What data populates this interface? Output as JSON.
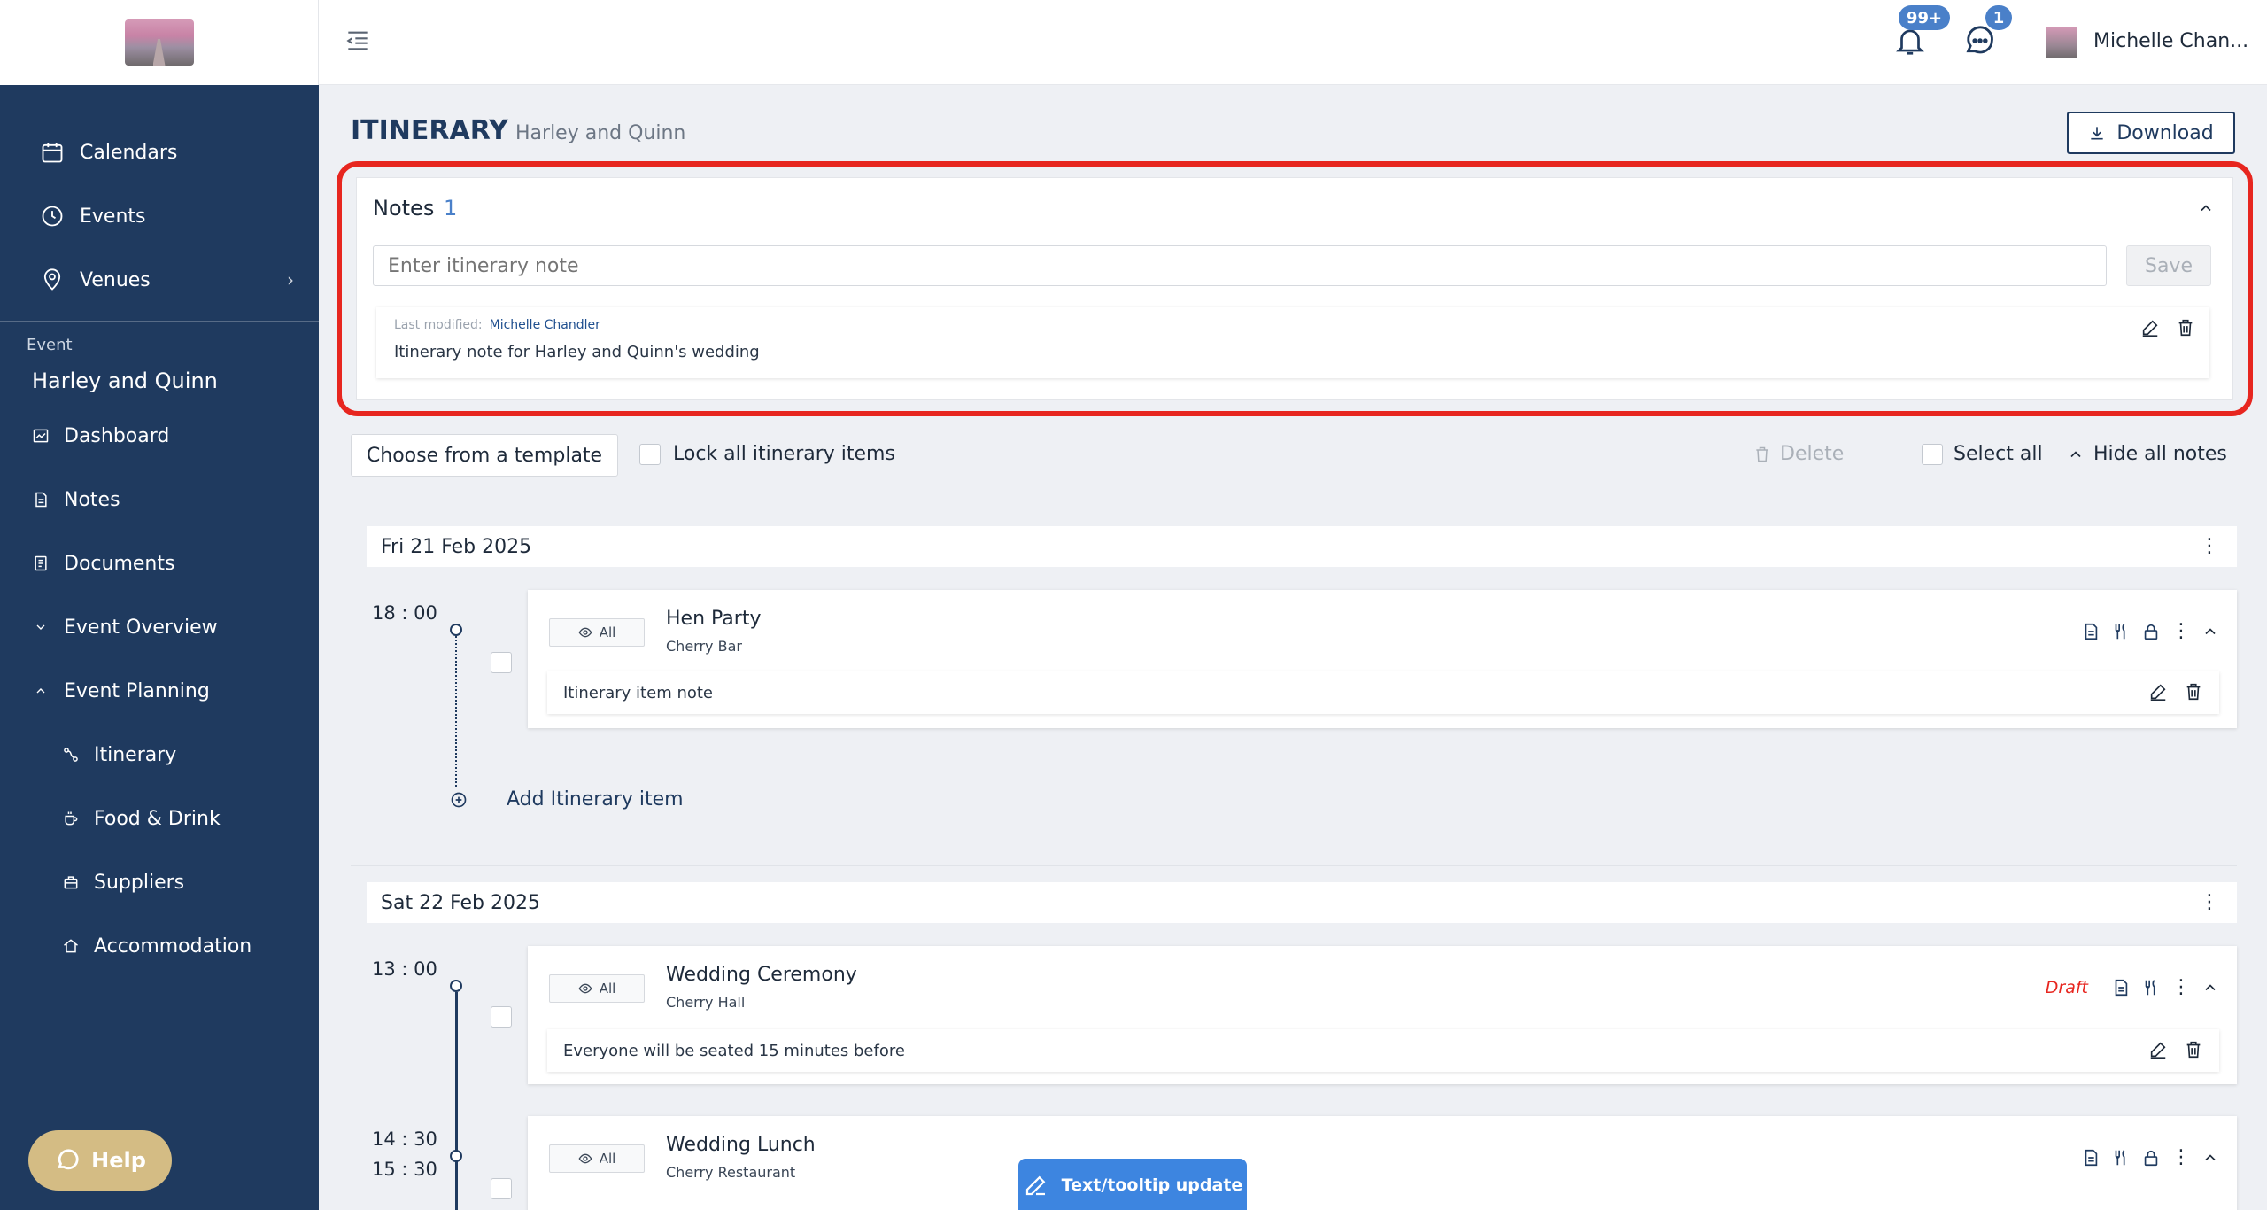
{
  "sidebar": {
    "nav": [
      {
        "label": "Calendars",
        "icon": "calendar-icon"
      },
      {
        "label": "Events",
        "icon": "clock-icon"
      },
      {
        "label": "Venues",
        "icon": "location-pin-icon"
      }
    ],
    "event_label": "Event",
    "event_name": "Harley and Quinn",
    "event_nav": [
      {
        "label": "Dashboard"
      },
      {
        "label": "Notes"
      },
      {
        "label": "Documents"
      },
      {
        "label": "Event Overview"
      },
      {
        "label": "Event Planning"
      },
      {
        "label": "Itinerary"
      },
      {
        "label": "Food & Drink"
      },
      {
        "label": "Suppliers"
      },
      {
        "label": "Accommodation"
      }
    ],
    "help_label": "Help"
  },
  "topbar": {
    "notifications_count": "99+",
    "messages_count": "1",
    "user_name": "Michelle Chan..."
  },
  "page": {
    "title": "ITINERARY",
    "subtitle": "Harley and Quinn",
    "download_label": "Download"
  },
  "notes": {
    "title": "Notes",
    "count": "1",
    "input_placeholder": "Enter itinerary note",
    "save_label": "Save",
    "items": [
      {
        "meta_label": "Last modified:",
        "author": "Michelle Chandler",
        "text": "Itinerary note for Harley and Quinn's wedding"
      }
    ]
  },
  "toolbar": {
    "template_label": "Choose from a template",
    "lock_label": "Lock all itinerary items",
    "delete_label": "Delete",
    "select_all_label": "Select all",
    "hide_notes_label": "Hide all notes"
  },
  "days": [
    {
      "date": "Fri 21 Feb 2025",
      "items": [
        {
          "time_h": "18",
          "time_m": "00",
          "visibility": "All",
          "title": "Hen Party",
          "venue": "Cherry Bar",
          "note": "Itinerary item note"
        }
      ],
      "add_label": "Add Itinerary item"
    },
    {
      "date": "Sat 22 Feb 2025",
      "items": [
        {
          "time_h": "13",
          "time_m": "00",
          "visibility": "All",
          "title": "Wedding Ceremony",
          "venue": "Cherry Hall",
          "status": "Draft",
          "note": "Everyone will be seated 15 minutes before"
        },
        {
          "time_h": "14",
          "time_m": "30",
          "end_h": "15",
          "end_m": "30",
          "visibility": "All",
          "title": "Wedding Lunch",
          "venue": "Cherry Restaurant"
        }
      ]
    }
  ],
  "toast": {
    "label": "Text/tooltip update"
  }
}
